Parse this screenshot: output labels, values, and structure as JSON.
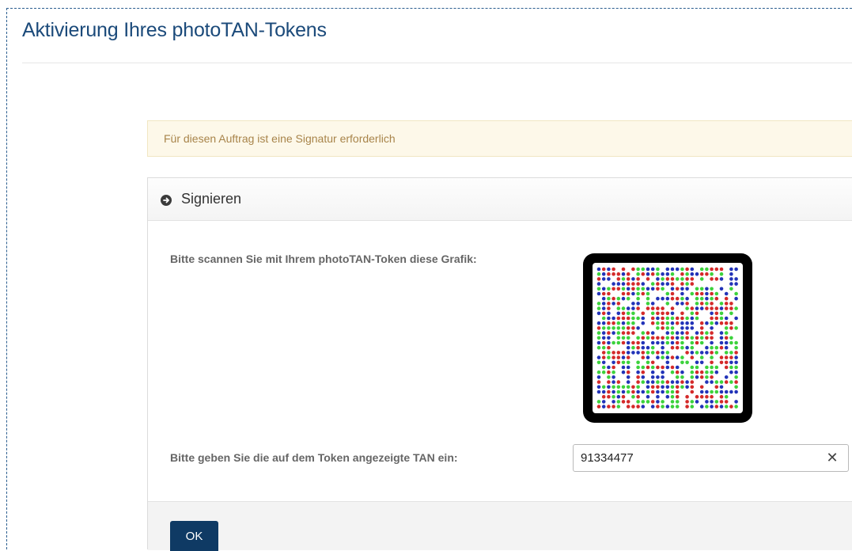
{
  "page": {
    "title": "Aktivierung Ihres photoTAN-Tokens"
  },
  "alert": {
    "text": "Für diesen Auftrag ist eine Signatur erforderlich",
    "color": "#a8844a"
  },
  "panel": {
    "title": "Signieren",
    "icon": "circle-arrow-right-icon",
    "scan_label": "Bitte scannen Sie mit Ihrem photoTAN-Token diese Grafik:",
    "tan_label": "Bitte geben Sie die auf dem Token angezeigte TAN ein:",
    "tan_value": "91334477",
    "clear_icon": "close-icon",
    "clear_symbol": "✕",
    "ok_label": "OK"
  },
  "phototan": {
    "colors": [
      "#d42a2a",
      "#2233b8",
      "#3cd23c"
    ],
    "frame_color": "#000000"
  },
  "colors": {
    "title": "#1b4a7a",
    "button": "#0f3a64"
  }
}
